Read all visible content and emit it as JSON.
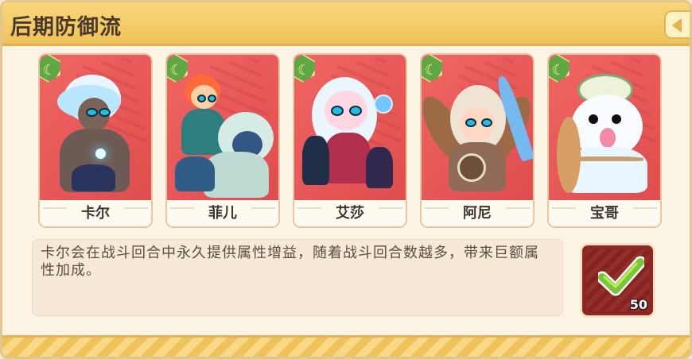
{
  "panel": {
    "title": "后期防御流",
    "description": "卡尔会在战斗回合中永久提供属性增益，随着战斗回合数越多，带来巨额属性加成。",
    "count": "50",
    "accent_colors": {
      "header": "#f0c35a",
      "card_bg": "#df4d4e",
      "badge": "#5fa843",
      "button": "#8f2623",
      "check": "#7bc53a"
    }
  },
  "heroes": [
    {
      "name": "卡尔",
      "icon": "moon-badge-icon"
    },
    {
      "name": "菲儿",
      "icon": "moon-badge-icon"
    },
    {
      "name": "艾莎",
      "icon": "moon-badge-icon"
    },
    {
      "name": "阿尼",
      "icon": "moon-badge-icon"
    },
    {
      "name": "宝哥",
      "icon": "moon-badge-icon"
    }
  ]
}
